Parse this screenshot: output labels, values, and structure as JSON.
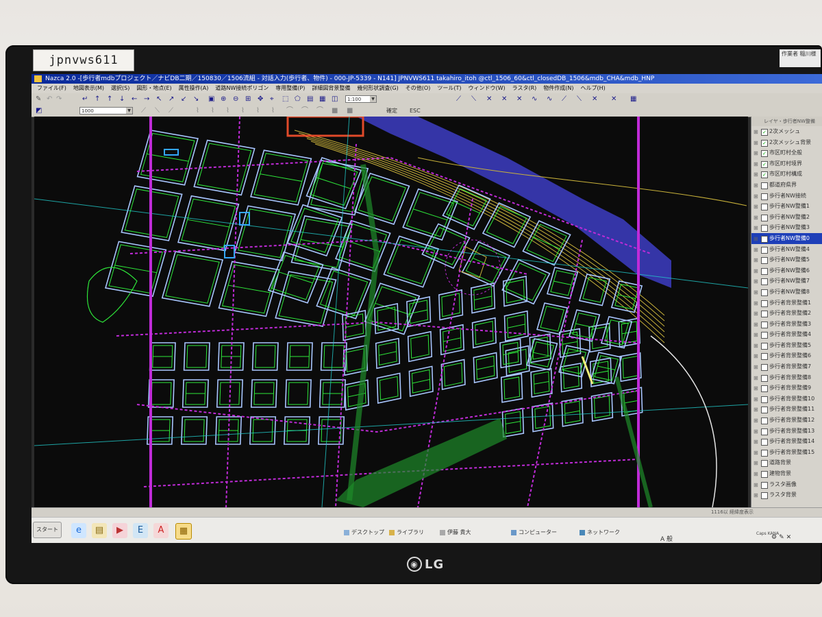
{
  "monitor": {
    "label": "jpnvws611",
    "brand": "LG",
    "corner_label": "作業者 稲川様"
  },
  "window": {
    "title": "Nazca 2.0 -[歩行者mdbプロジェクト／ナビDB二期／150830／1506流組 - 対話入力(歩行者、物件) - 000-JP-5339 - N141] JPNVWS611 takahiro_itoh @ctl_1506_60&ctl_closedDB_1506&mdb_CHA&mdb_HNP"
  },
  "menu": [
    "ファイル(F)",
    "地図表示(M)",
    "選択(S)",
    "図形・地点(E)",
    "属性操作(A)",
    "道路NW接続ポリゴン",
    "専用整備(P)",
    "詳細図背景整備",
    "幾何形状調査(G)",
    "その他(O)",
    "ツール(T)",
    "ウィンドウ(W)",
    "ラスタ(R)",
    "物件作成(N)",
    "ヘルプ(H)"
  ],
  "toolbar": {
    "scale_value": "1:100",
    "layer_value": "1000",
    "confirm_label": "確定",
    "esc_label": "ESC"
  },
  "sidepanel": {
    "header": "レイヤ・歩行者NW整備",
    "layers": [
      {
        "label": "2次メッシュ",
        "checked": true
      },
      {
        "label": "2次メッシュ背景",
        "checked": true
      },
      {
        "label": "市区町村全般",
        "checked": true
      },
      {
        "label": "市区町村境界",
        "checked": true
      },
      {
        "label": "市区町村構成",
        "checked": true
      },
      {
        "label": "都道府県界",
        "checked": false
      },
      {
        "label": "歩行者NW接続",
        "checked": false
      },
      {
        "label": "歩行者NW整備1",
        "checked": false
      },
      {
        "label": "歩行者NW整備2",
        "checked": false
      },
      {
        "label": "歩行者NW整備3",
        "checked": false
      },
      {
        "label": "歩行者NW整備0",
        "checked": false,
        "selected": true
      },
      {
        "label": "歩行者NW整備4",
        "checked": false
      },
      {
        "label": "歩行者NW整備5",
        "checked": false
      },
      {
        "label": "歩行者NW整備6",
        "checked": false
      },
      {
        "label": "歩行者NW整備7",
        "checked": false
      },
      {
        "label": "歩行者NW整備8",
        "checked": false
      },
      {
        "label": "歩行者背景整備1",
        "checked": false
      },
      {
        "label": "歩行者背景整備2",
        "checked": false
      },
      {
        "label": "歩行者背景整備3",
        "checked": false
      },
      {
        "label": "歩行者背景整備4",
        "checked": false
      },
      {
        "label": "歩行者背景整備5",
        "checked": false
      },
      {
        "label": "歩行者背景整備6",
        "checked": false
      },
      {
        "label": "歩行者背景整備7",
        "checked": false
      },
      {
        "label": "歩行者背景整備8",
        "checked": false
      },
      {
        "label": "歩行者背景整備9",
        "checked": false
      },
      {
        "label": "歩行者背景整備10",
        "checked": false
      },
      {
        "label": "歩行者背景整備11",
        "checked": false
      },
      {
        "label": "歩行者背景整備12",
        "checked": false
      },
      {
        "label": "歩行者背景整備13",
        "checked": false
      },
      {
        "label": "歩行者背景整備14",
        "checked": false
      },
      {
        "label": "歩行者背景整備15",
        "checked": false
      },
      {
        "label": "道路背景",
        "checked": false
      },
      {
        "label": "建物背景",
        "checked": false
      },
      {
        "label": "ラスタ画像",
        "checked": false
      },
      {
        "label": "ラスタ背景",
        "checked": false
      }
    ]
  },
  "statusbar": {
    "text": "1116以 経緯度表示"
  },
  "taskbar": {
    "start_label": "スタート",
    "items": [
      "デスクトップ",
      "ライブラリ",
      "伊藤 貴大",
      "コンピューター",
      "ネットワーク"
    ],
    "ime": "A 般",
    "clock": "Caps KANA"
  },
  "colors": {
    "building": "#2ee83a",
    "road": "#a9c6ff",
    "walkway": "#c02bd8",
    "river": "#3a3ab8",
    "rail": "#c9b23a",
    "boundary": "#c02bd8",
    "centerline": "#22c9c9"
  }
}
